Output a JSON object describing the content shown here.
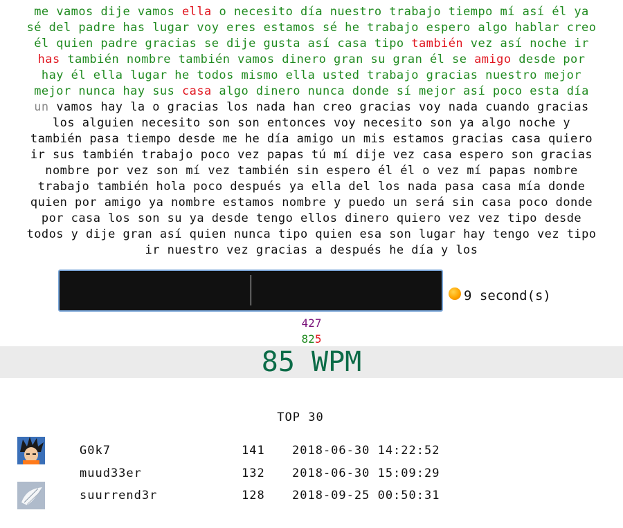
{
  "text_lines": [
    [
      {
        "t": "me",
        "s": "correct"
      },
      {
        "t": "vamos",
        "s": "correct"
      },
      {
        "t": "dije",
        "s": "correct"
      },
      {
        "t": "vamos",
        "s": "correct"
      },
      {
        "t": "ella",
        "s": "wrong"
      },
      {
        "t": "o",
        "s": "correct"
      },
      {
        "t": "necesito",
        "s": "correct"
      },
      {
        "t": "día",
        "s": "correct"
      },
      {
        "t": "nuestro",
        "s": "correct"
      },
      {
        "t": "trabajo",
        "s": "correct"
      },
      {
        "t": "tiempo",
        "s": "correct"
      },
      {
        "t": "mí",
        "s": "correct"
      },
      {
        "t": "así",
        "s": "correct"
      },
      {
        "t": "él",
        "s": "correct"
      },
      {
        "t": "ya",
        "s": "correct"
      }
    ],
    [
      {
        "t": "sé",
        "s": "correct"
      },
      {
        "t": "del",
        "s": "correct"
      },
      {
        "t": "padre",
        "s": "correct"
      },
      {
        "t": "has",
        "s": "correct"
      },
      {
        "t": "lugar",
        "s": "correct"
      },
      {
        "t": "voy",
        "s": "correct"
      },
      {
        "t": "eres",
        "s": "correct"
      },
      {
        "t": "estamos",
        "s": "correct"
      },
      {
        "t": "sé",
        "s": "correct"
      },
      {
        "t": "he",
        "s": "correct"
      },
      {
        "t": "trabajo",
        "s": "correct"
      },
      {
        "t": "espero",
        "s": "correct"
      },
      {
        "t": "algo",
        "s": "correct"
      },
      {
        "t": "hablar",
        "s": "correct"
      },
      {
        "t": "creo",
        "s": "correct"
      }
    ],
    [
      {
        "t": "él",
        "s": "correct"
      },
      {
        "t": "quien",
        "s": "correct"
      },
      {
        "t": "padre",
        "s": "correct"
      },
      {
        "t": "gracias",
        "s": "correct"
      },
      {
        "t": "se",
        "s": "correct"
      },
      {
        "t": "dije",
        "s": "correct"
      },
      {
        "t": "gusta",
        "s": "correct"
      },
      {
        "t": "así",
        "s": "correct"
      },
      {
        "t": "casa",
        "s": "correct"
      },
      {
        "t": "tipo",
        "s": "correct"
      },
      {
        "t": "también",
        "s": "wrong"
      },
      {
        "t": "vez",
        "s": "correct"
      },
      {
        "t": "así",
        "s": "correct"
      },
      {
        "t": "noche",
        "s": "correct"
      },
      {
        "t": "ir",
        "s": "correct"
      }
    ],
    [
      {
        "t": "has",
        "s": "wrong"
      },
      {
        "t": "también",
        "s": "correct"
      },
      {
        "t": "nombre",
        "s": "correct"
      },
      {
        "t": "también",
        "s": "correct"
      },
      {
        "t": "vamos",
        "s": "correct"
      },
      {
        "t": "dinero",
        "s": "correct"
      },
      {
        "t": "gran",
        "s": "correct"
      },
      {
        "t": "su",
        "s": "correct"
      },
      {
        "t": "gran",
        "s": "correct"
      },
      {
        "t": "él",
        "s": "correct"
      },
      {
        "t": "se",
        "s": "correct"
      },
      {
        "t": "amigo",
        "s": "wrong"
      },
      {
        "t": "desde",
        "s": "correct"
      },
      {
        "t": "por",
        "s": "correct"
      }
    ],
    [
      {
        "t": "hay",
        "s": "correct"
      },
      {
        "t": "él",
        "s": "correct"
      },
      {
        "t": "ella",
        "s": "correct"
      },
      {
        "t": "lugar",
        "s": "correct"
      },
      {
        "t": "he",
        "s": "correct"
      },
      {
        "t": "todos",
        "s": "correct"
      },
      {
        "t": "mismo",
        "s": "correct"
      },
      {
        "t": "ella",
        "s": "correct"
      },
      {
        "t": "usted",
        "s": "correct"
      },
      {
        "t": "trabajo",
        "s": "correct"
      },
      {
        "t": "gracias",
        "s": "correct"
      },
      {
        "t": "nuestro",
        "s": "correct"
      },
      {
        "t": "mejor",
        "s": "correct"
      }
    ],
    [
      {
        "t": "mejor",
        "s": "correct"
      },
      {
        "t": "nunca",
        "s": "correct"
      },
      {
        "t": "hay",
        "s": "correct"
      },
      {
        "t": "sus",
        "s": "correct"
      },
      {
        "t": "casa",
        "s": "wrong"
      },
      {
        "t": "algo",
        "s": "correct"
      },
      {
        "t": "dinero",
        "s": "correct"
      },
      {
        "t": "nunca",
        "s": "correct"
      },
      {
        "t": "donde",
        "s": "correct"
      },
      {
        "t": "sí",
        "s": "correct"
      },
      {
        "t": "mejor",
        "s": "correct"
      },
      {
        "t": "así",
        "s": "correct"
      },
      {
        "t": "poco",
        "s": "correct"
      },
      {
        "t": "esta",
        "s": "correct"
      },
      {
        "t": "día",
        "s": "correct"
      }
    ],
    [
      {
        "t": "un",
        "s": "current"
      },
      {
        "t": "vamos",
        "s": "pending"
      },
      {
        "t": "hay",
        "s": "pending"
      },
      {
        "t": "la",
        "s": "pending"
      },
      {
        "t": "o",
        "s": "pending"
      },
      {
        "t": "gracias",
        "s": "pending"
      },
      {
        "t": "los",
        "s": "pending"
      },
      {
        "t": "nada",
        "s": "pending"
      },
      {
        "t": "han",
        "s": "pending"
      },
      {
        "t": "creo",
        "s": "pending"
      },
      {
        "t": "gracias",
        "s": "pending"
      },
      {
        "t": "voy",
        "s": "pending"
      },
      {
        "t": "nada",
        "s": "pending"
      },
      {
        "t": "cuando",
        "s": "pending"
      },
      {
        "t": "gracias",
        "s": "pending"
      }
    ],
    [
      {
        "t": "los",
        "s": "pending"
      },
      {
        "t": "alguien",
        "s": "pending"
      },
      {
        "t": "necesito",
        "s": "pending"
      },
      {
        "t": "son",
        "s": "pending"
      },
      {
        "t": "son",
        "s": "pending"
      },
      {
        "t": "entonces",
        "s": "pending"
      },
      {
        "t": "voy",
        "s": "pending"
      },
      {
        "t": "necesito",
        "s": "pending"
      },
      {
        "t": "son",
        "s": "pending"
      },
      {
        "t": "ya",
        "s": "pending"
      },
      {
        "t": "algo",
        "s": "pending"
      },
      {
        "t": "noche",
        "s": "pending"
      },
      {
        "t": "y",
        "s": "pending"
      }
    ],
    [
      {
        "t": "también",
        "s": "pending"
      },
      {
        "t": "pasa",
        "s": "pending"
      },
      {
        "t": "tiempo",
        "s": "pending"
      },
      {
        "t": "desde",
        "s": "pending"
      },
      {
        "t": "me",
        "s": "pending"
      },
      {
        "t": "he",
        "s": "pending"
      },
      {
        "t": "día",
        "s": "pending"
      },
      {
        "t": "amigo",
        "s": "pending"
      },
      {
        "t": "un",
        "s": "pending"
      },
      {
        "t": "mis",
        "s": "pending"
      },
      {
        "t": "estamos",
        "s": "pending"
      },
      {
        "t": "gracias",
        "s": "pending"
      },
      {
        "t": "casa",
        "s": "pending"
      },
      {
        "t": "quiero",
        "s": "pending"
      }
    ],
    [
      {
        "t": "ir",
        "s": "pending"
      },
      {
        "t": "sus",
        "s": "pending"
      },
      {
        "t": "también",
        "s": "pending"
      },
      {
        "t": "trabajo",
        "s": "pending"
      },
      {
        "t": "poco",
        "s": "pending"
      },
      {
        "t": "vez",
        "s": "pending"
      },
      {
        "t": "papas",
        "s": "pending"
      },
      {
        "t": "tú",
        "s": "pending"
      },
      {
        "t": "mí",
        "s": "pending"
      },
      {
        "t": "dije",
        "s": "pending"
      },
      {
        "t": "vez",
        "s": "pending"
      },
      {
        "t": "casa",
        "s": "pending"
      },
      {
        "t": "espero",
        "s": "pending"
      },
      {
        "t": "son",
        "s": "pending"
      },
      {
        "t": "gracias",
        "s": "pending"
      }
    ],
    [
      {
        "t": "nombre",
        "s": "pending"
      },
      {
        "t": "por",
        "s": "pending"
      },
      {
        "t": "vez",
        "s": "pending"
      },
      {
        "t": "son",
        "s": "pending"
      },
      {
        "t": "mí",
        "s": "pending"
      },
      {
        "t": "vez",
        "s": "pending"
      },
      {
        "t": "también",
        "s": "pending"
      },
      {
        "t": "sin",
        "s": "pending"
      },
      {
        "t": "espero",
        "s": "pending"
      },
      {
        "t": "él",
        "s": "pending"
      },
      {
        "t": "él",
        "s": "pending"
      },
      {
        "t": "o",
        "s": "pending"
      },
      {
        "t": "vez",
        "s": "pending"
      },
      {
        "t": "mí",
        "s": "pending"
      },
      {
        "t": "papas",
        "s": "pending"
      },
      {
        "t": "nombre",
        "s": "pending"
      }
    ],
    [
      {
        "t": "trabajo",
        "s": "pending"
      },
      {
        "t": "también",
        "s": "pending"
      },
      {
        "t": "hola",
        "s": "pending"
      },
      {
        "t": "poco",
        "s": "pending"
      },
      {
        "t": "después",
        "s": "pending"
      },
      {
        "t": "ya",
        "s": "pending"
      },
      {
        "t": "ella",
        "s": "pending"
      },
      {
        "t": "del",
        "s": "pending"
      },
      {
        "t": "los",
        "s": "pending"
      },
      {
        "t": "nada",
        "s": "pending"
      },
      {
        "t": "pasa",
        "s": "pending"
      },
      {
        "t": "casa",
        "s": "pending"
      },
      {
        "t": "mía",
        "s": "pending"
      },
      {
        "t": "donde",
        "s": "pending"
      }
    ],
    [
      {
        "t": "quien",
        "s": "pending"
      },
      {
        "t": "por",
        "s": "pending"
      },
      {
        "t": "amigo",
        "s": "pending"
      },
      {
        "t": "ya",
        "s": "pending"
      },
      {
        "t": "nombre",
        "s": "pending"
      },
      {
        "t": "estamos",
        "s": "pending"
      },
      {
        "t": "nombre",
        "s": "pending"
      },
      {
        "t": "y",
        "s": "pending"
      },
      {
        "t": "puedo",
        "s": "pending"
      },
      {
        "t": "un",
        "s": "pending"
      },
      {
        "t": "será",
        "s": "pending"
      },
      {
        "t": "sin",
        "s": "pending"
      },
      {
        "t": "casa",
        "s": "pending"
      },
      {
        "t": "poco",
        "s": "pending"
      },
      {
        "t": "donde",
        "s": "pending"
      }
    ],
    [
      {
        "t": "por",
        "s": "pending"
      },
      {
        "t": "casa",
        "s": "pending"
      },
      {
        "t": "los",
        "s": "pending"
      },
      {
        "t": "son",
        "s": "pending"
      },
      {
        "t": "su",
        "s": "pending"
      },
      {
        "t": "ya",
        "s": "pending"
      },
      {
        "t": "desde",
        "s": "pending"
      },
      {
        "t": "tengo",
        "s": "pending"
      },
      {
        "t": "ellos",
        "s": "pending"
      },
      {
        "t": "dinero",
        "s": "pending"
      },
      {
        "t": "quiero",
        "s": "pending"
      },
      {
        "t": "vez",
        "s": "pending"
      },
      {
        "t": "vez",
        "s": "pending"
      },
      {
        "t": "tipo",
        "s": "pending"
      },
      {
        "t": "desde",
        "s": "pending"
      }
    ],
    [
      {
        "t": "todos",
        "s": "pending"
      },
      {
        "t": "y",
        "s": "pending"
      },
      {
        "t": "dije",
        "s": "pending"
      },
      {
        "t": "gran",
        "s": "pending"
      },
      {
        "t": "así",
        "s": "pending"
      },
      {
        "t": "quien",
        "s": "pending"
      },
      {
        "t": "nunca",
        "s": "pending"
      },
      {
        "t": "tipo",
        "s": "pending"
      },
      {
        "t": "quien",
        "s": "pending"
      },
      {
        "t": "esa",
        "s": "pending"
      },
      {
        "t": "son",
        "s": "pending"
      },
      {
        "t": "lugar",
        "s": "pending"
      },
      {
        "t": "hay",
        "s": "pending"
      },
      {
        "t": "tengo",
        "s": "pending"
      },
      {
        "t": "vez",
        "s": "pending"
      },
      {
        "t": "tipo",
        "s": "pending"
      }
    ],
    [
      {
        "t": "ir",
        "s": "pending"
      },
      {
        "t": "nuestro",
        "s": "pending"
      },
      {
        "t": "vez",
        "s": "pending"
      },
      {
        "t": "gracias",
        "s": "pending"
      },
      {
        "t": "a",
        "s": "pending"
      },
      {
        "t": "después",
        "s": "pending"
      },
      {
        "t": "he",
        "s": "pending"
      },
      {
        "t": "día",
        "s": "pending"
      },
      {
        "t": "y",
        "s": "pending"
      },
      {
        "t": "los",
        "s": "pending"
      }
    ]
  ],
  "input": {
    "value": ""
  },
  "timer": {
    "label": "9 second(s)",
    "icon": "timer-dot-icon",
    "color": "#ffa500"
  },
  "stats": {
    "keystrokes": "427",
    "correct_words": "82",
    "wrong_words": "5",
    "wpm": "85 WPM"
  },
  "leaderboard": {
    "title": "TOP 30",
    "rows": [
      {
        "user": "G0k7",
        "score": "141",
        "date": "2018-06-30 14:22:52",
        "avatar": "goku-avatar"
      },
      {
        "user": "muud33er",
        "score": "132",
        "date": "2018-06-30 15:09:29",
        "avatar": ""
      },
      {
        "user": "suurrend3r",
        "score": "128",
        "date": "2018-09-25 00:50:31",
        "avatar": "white-flag-avatar"
      }
    ]
  },
  "colors": {
    "correct": "#1f8a1f",
    "wrong": "#e0141e",
    "current": "#8a8a8a",
    "pending": "#111111",
    "wpm": "#0b6b47",
    "keystrokes": "#7a117a",
    "input_bg": "#111111",
    "input_border": "#7aa6d8"
  }
}
